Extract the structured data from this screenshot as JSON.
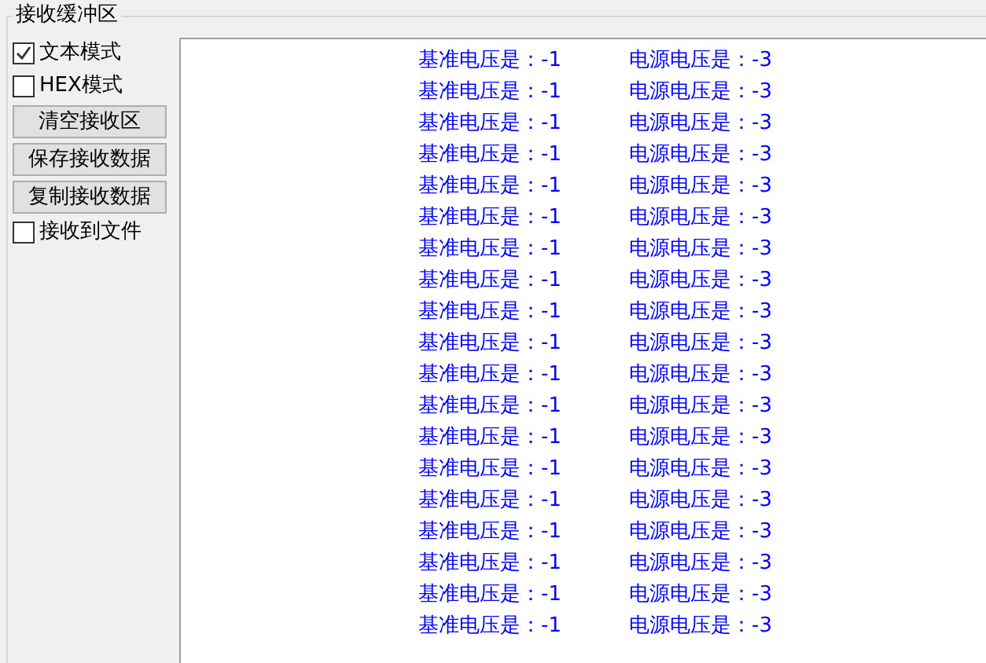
{
  "receive_buffer": {
    "title": "接收缓冲区",
    "controls": [
      {
        "kind": "checkbox",
        "label": "文本模式",
        "checked": true
      },
      {
        "kind": "checkbox",
        "label": "HEX模式",
        "checked": false
      },
      {
        "kind": "button",
        "label": "清空接收区"
      },
      {
        "kind": "button",
        "label": "保存接收数据"
      },
      {
        "kind": "button",
        "label": "复制接收数据"
      },
      {
        "kind": "checkbox",
        "label": "接收到文件",
        "checked": false
      }
    ],
    "lines": [
      {
        "reference": "基准电压是：-1",
        "supply": "电源电压是：-3"
      },
      {
        "reference": "基准电压是：-1",
        "supply": "电源电压是：-3"
      },
      {
        "reference": "基准电压是：-1",
        "supply": "电源电压是：-3"
      },
      {
        "reference": "基准电压是：-1",
        "supply": "电源电压是：-3"
      },
      {
        "reference": "基准电压是：-1",
        "supply": "电源电压是：-3"
      },
      {
        "reference": "基准电压是：-1",
        "supply": "电源电压是：-3"
      },
      {
        "reference": "基准电压是：-1",
        "supply": "电源电压是：-3"
      },
      {
        "reference": "基准电压是：-1",
        "supply": "电源电压是：-3"
      },
      {
        "reference": "基准电压是：-1",
        "supply": "电源电压是：-3"
      },
      {
        "reference": "基准电压是：-1",
        "supply": "电源电压是：-3"
      },
      {
        "reference": "基准电压是：-1",
        "supply": "电源电压是：-3"
      },
      {
        "reference": "基准电压是：-1",
        "supply": "电源电压是：-3"
      },
      {
        "reference": "基准电压是：-1",
        "supply": "电源电压是：-3"
      },
      {
        "reference": "基准电压是：-1",
        "supply": "电源电压是：-3"
      },
      {
        "reference": "基准电压是：-1",
        "supply": "电源电压是：-3"
      },
      {
        "reference": "基准电压是：-1",
        "supply": "电源电压是：-3"
      },
      {
        "reference": "基准电压是：-1",
        "supply": "电源电压是：-3"
      },
      {
        "reference": "基准电压是：-1",
        "supply": "电源电压是：-3"
      },
      {
        "reference": "基准电压是：-1",
        "supply": "电源电压是：-3"
      }
    ]
  }
}
